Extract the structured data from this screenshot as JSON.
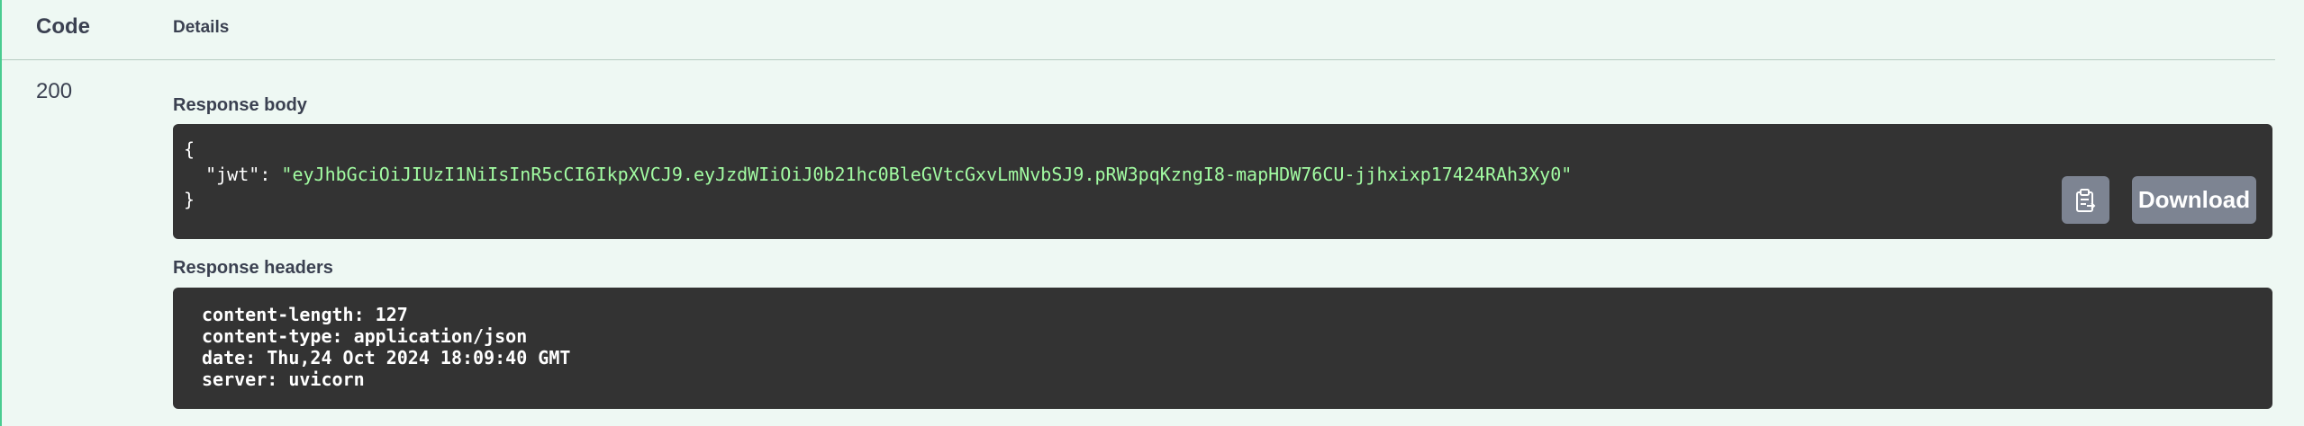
{
  "table_header": {
    "code_label": "Code",
    "details_label": "Details"
  },
  "response": {
    "status_code": "200",
    "body_label": "Response body",
    "body": {
      "open_brace": "{",
      "key": "\"jwt\"",
      "colon": ": ",
      "value": "\"eyJhbGciOiJIUzI1NiIsInR5cCI6IkpXVCJ9.eyJzdWIiOiJ0b21hc0BleGVtcGxvLmNvbSJ9.pRW3pqKzngI8-mapHDW76CU-jjhxixp17424RAh3Xy0\"",
      "close_brace": "}"
    },
    "headers_label": "Response headers",
    "headers": [
      "content-length: 127",
      "content-type: application/json",
      "date: Thu,24 Oct 2024 18:09:40 GMT",
      "server: uvicorn"
    ],
    "copy_icon": "clipboard-icon",
    "download_label": "Download"
  }
}
